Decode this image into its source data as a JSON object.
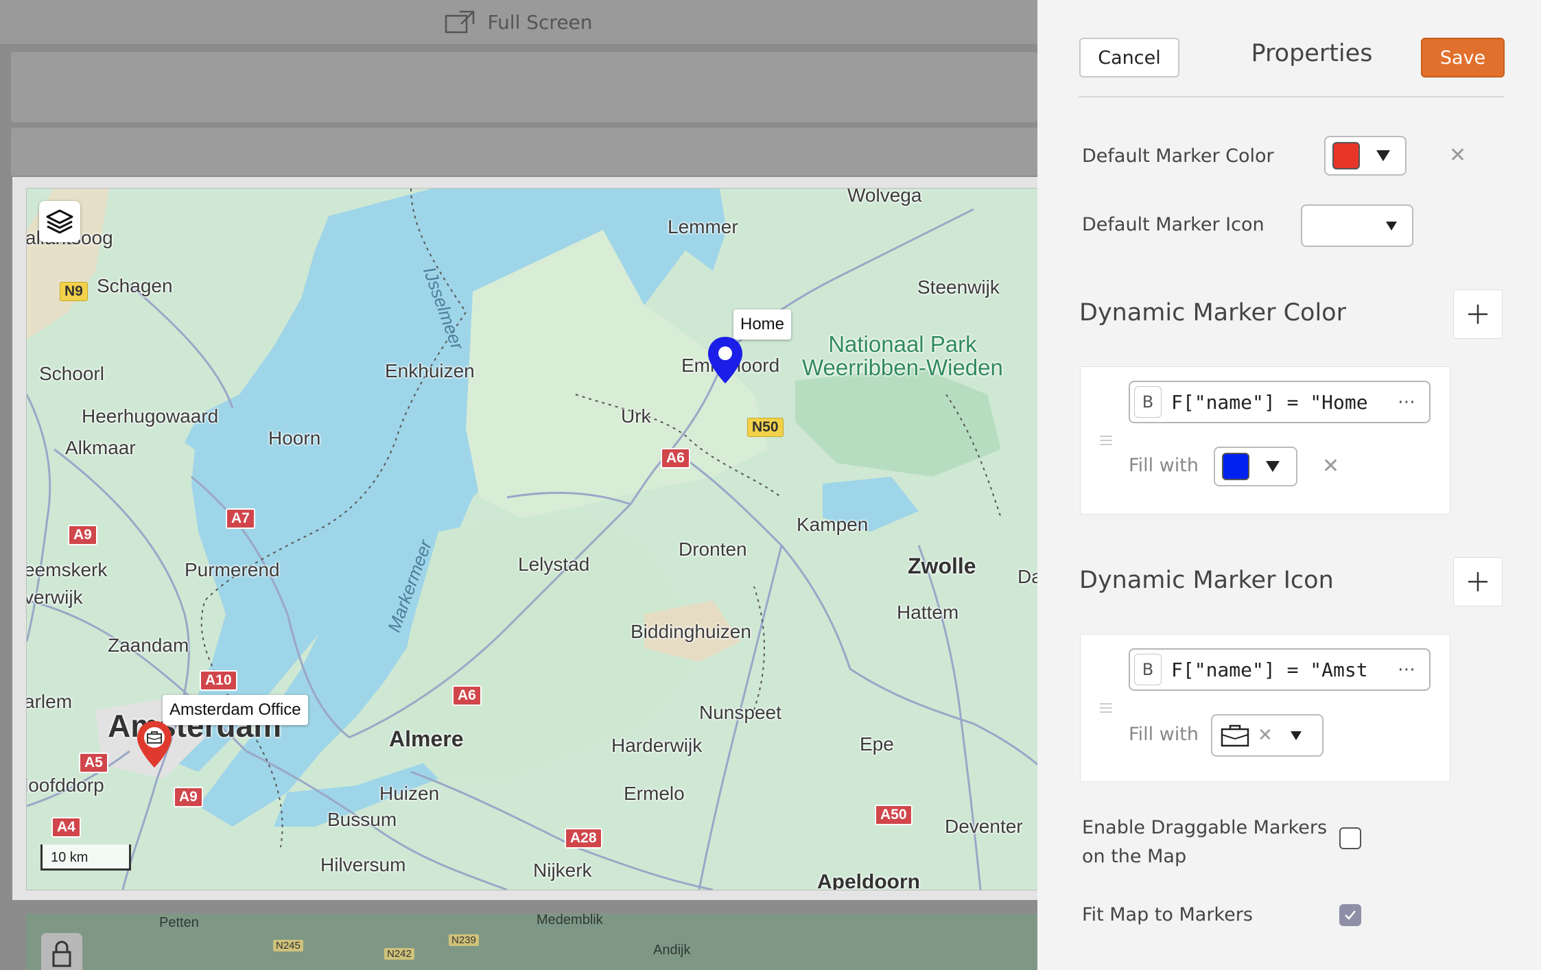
{
  "toolbar": {
    "fullscreen_label": "Full Screen"
  },
  "map": {
    "places": {
      "wolvega": "Wolvega",
      "lemmer": "Lemmer",
      "steenwijk": "Steenwijk",
      "callantsoog": "allantsoog",
      "schagen": "Schagen",
      "schoorl": "Schoorl",
      "enkhuizen": "Enkhuizen",
      "heerhugowaard": "Heerhugowaard",
      "alkmaar": "Alkmaar",
      "hoorn": "Hoorn",
      "urk": "Urk",
      "emmeloord": "Emmeloord",
      "kampen": "Kampen",
      "dronten": "Dronten",
      "lelystad": "Lelystad",
      "zwolle": "Zwolle",
      "da": "Da",
      "hattem": "Hattem",
      "biddinghuizen": "Biddinghuizen",
      "heemskerk": "eemskerk",
      "beverwijk": "verwijk",
      "purmerend": "Purmerend",
      "zaandam": "Zaandam",
      "haarlem": "arlem",
      "amsterdam": "Amsterdam",
      "almere": "Almere",
      "nunspeet": "Nunspeet",
      "harderwijk": "Harderwijk",
      "epe": "Epe",
      "hoofddorp": "loofddorp",
      "huizen": "Huizen",
      "ermelo": "Ermelo",
      "bussum": "Bussum",
      "deventer": "Deventer",
      "hilversum": "Hilversum",
      "nijkerk": "Nijkerk",
      "apeldoorn": "Apeldoorn"
    },
    "park": {
      "line1": "Nationaal Park",
      "line2": "Weerribben-Wieden"
    },
    "water": {
      "ijsselmeer": "IJsselmeer",
      "markermeer": "Markermeer"
    },
    "roads": {
      "n9": "N9",
      "n50": "N50",
      "a6_north": "A6",
      "a7": "A7",
      "a9_north": "A9",
      "a10": "A10",
      "a6_south": "A6",
      "a5": "A5",
      "a9_south": "A9",
      "a4": "A4",
      "a28": "A28",
      "a50": "A50"
    },
    "markers": {
      "home": {
        "label": "Home",
        "color": "#1a1ee6",
        "icon": "circle-icon"
      },
      "office": {
        "label": "Amsterdam Office",
        "color": "#e03a2e",
        "icon": "briefcase-icon"
      }
    },
    "scale_label": "10 km"
  },
  "minimap": {
    "places": {
      "petten": "Petten",
      "medemblik": "Medemblik",
      "andijk": "Andijk"
    },
    "roads": {
      "n245": "N245",
      "n242": "N242",
      "n239": "N239"
    }
  },
  "panel": {
    "cancel_label": "Cancel",
    "title": "Properties",
    "save_label": "Save",
    "default_marker_color_label": "Default Marker Color",
    "default_marker_color": "#e8352a",
    "default_marker_icon_label": "Default Marker Icon",
    "dynamic_color": {
      "heading": "Dynamic Marker Color",
      "rule": {
        "mode": "B",
        "expression": "F[\"name\"] = \"Home",
        "fill_label": "Fill with",
        "fill_color": "#0022ee"
      }
    },
    "dynamic_icon": {
      "heading": "Dynamic Marker Icon",
      "rule": {
        "mode": "B",
        "expression": "F[\"name\"] = \"Amst",
        "fill_label": "Fill with",
        "fill_icon": "briefcase-icon"
      }
    },
    "draggable_label_line1": "Enable Draggable Markers",
    "draggable_label_line2": "on the Map",
    "draggable_checked": false,
    "fit_label": "Fit Map to Markers",
    "fit_checked": true,
    "more_icon": "ellipsis-icon"
  }
}
